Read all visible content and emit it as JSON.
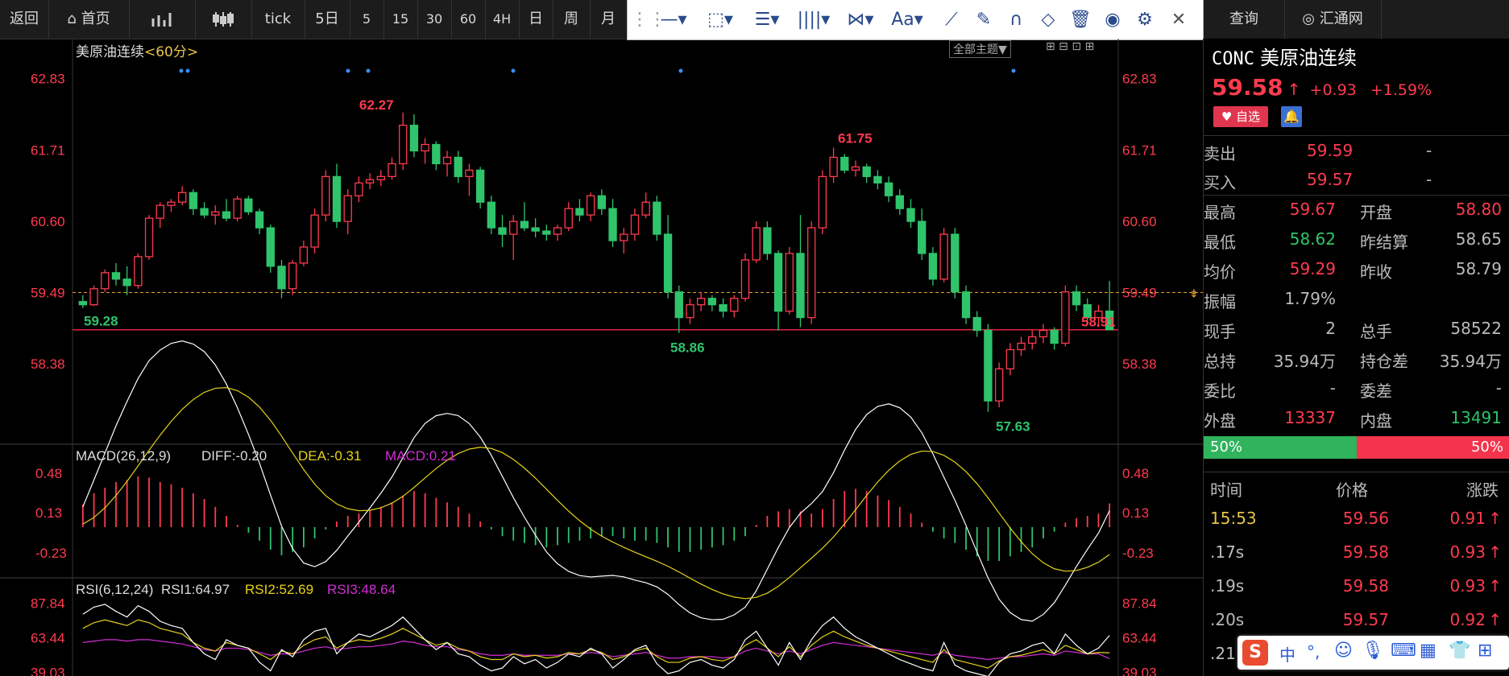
{
  "topbar": {
    "items": [
      "返回",
      "首页",
      "",
      "",
      "tick",
      "5日",
      "5",
      "15",
      "30",
      "60",
      "4H",
      "日",
      "周",
      "月"
    ],
    "right_items": [
      "查询",
      "汇通网"
    ]
  },
  "toolbar": {
    "tools": [
      "line-tool",
      "rect-tool",
      "fib-tool",
      "parallel-tool",
      "pattern-tool",
      "text-tool",
      "ruler-tool",
      "pen-tool",
      "magnet-tool",
      "eraser-tool",
      "delete-tool",
      "eye-tool",
      "settings-tool",
      "close-tool"
    ],
    "text_label": "Aa"
  },
  "chart": {
    "title": "美原油连续",
    "period": "<60分>",
    "theme_button": "全部主题▼",
    "price_ticks": [
      "62.83",
      "61.71",
      "60.60",
      "59.49",
      "58.38"
    ],
    "annotations": {
      "high1": "62.27",
      "high2": "61.75",
      "low1": "59.28",
      "low2": "58.86",
      "low3": "57.63",
      "last": "58.91"
    },
    "macd": {
      "title": "MACD(26,12,9)",
      "diff": "DIFF:-0.20",
      "dea": "DEA:-0.31",
      "macd": "MACD:0.21",
      "ticks": [
        "0.48",
        "0.13",
        "-0.23"
      ]
    },
    "rsi": {
      "title": "RSI(6,12,24)",
      "rsi1": "RSI1:64.97",
      "rsi2": "RSI2:52.69",
      "rsi3": "RSI3:48.64",
      "ticks": [
        "87.84",
        "63.44",
        "39.03"
      ]
    },
    "colors": {
      "up": "#ff3b4e",
      "down": "#2fc46c",
      "bg": "#000",
      "diff": "#ffffff",
      "dea": "#e6d21a",
      "macd": "#d22ed6"
    }
  },
  "chart_data": {
    "type": "candlestick",
    "price_range": [
      57.3,
      63.2
    ],
    "candles": [
      [
        59.35,
        59.45,
        59.25,
        59.3
      ],
      [
        59.3,
        59.6,
        59.28,
        59.55
      ],
      [
        59.55,
        59.85,
        59.5,
        59.8
      ],
      [
        59.8,
        59.95,
        59.6,
        59.7
      ],
      [
        59.7,
        59.9,
        59.45,
        59.6
      ],
      [
        59.6,
        60.1,
        59.55,
        60.05
      ],
      [
        60.05,
        60.7,
        60.0,
        60.65
      ],
      [
        60.65,
        60.9,
        60.5,
        60.85
      ],
      [
        60.85,
        60.95,
        60.75,
        60.9
      ],
      [
        60.9,
        61.15,
        60.85,
        61.05
      ],
      [
        61.05,
        61.1,
        60.7,
        60.8
      ],
      [
        60.8,
        60.9,
        60.65,
        60.7
      ],
      [
        60.7,
        60.85,
        60.55,
        60.75
      ],
      [
        60.75,
        60.95,
        60.6,
        60.65
      ],
      [
        60.65,
        61.0,
        60.6,
        60.95
      ],
      [
        60.95,
        61.0,
        60.7,
        60.75
      ],
      [
        60.75,
        60.8,
        60.4,
        60.5
      ],
      [
        60.5,
        60.55,
        59.8,
        59.9
      ],
      [
        59.9,
        60.0,
        59.4,
        59.55
      ],
      [
        59.55,
        60.0,
        59.45,
        59.95
      ],
      [
        59.95,
        60.3,
        59.9,
        60.2
      ],
      [
        60.2,
        60.8,
        60.1,
        60.7
      ],
      [
        60.7,
        61.4,
        60.6,
        61.3
      ],
      [
        61.3,
        61.5,
        60.5,
        60.6
      ],
      [
        60.6,
        61.1,
        60.4,
        61.0
      ],
      [
        61.0,
        61.3,
        60.9,
        61.2
      ],
      [
        61.2,
        61.35,
        61.1,
        61.25
      ],
      [
        61.25,
        61.4,
        61.15,
        61.3
      ],
      [
        61.3,
        61.6,
        61.25,
        61.5
      ],
      [
        61.5,
        62.3,
        61.4,
        62.1
      ],
      [
        62.1,
        62.27,
        61.6,
        61.7
      ],
      [
        61.7,
        61.9,
        61.5,
        61.8
      ],
      [
        61.8,
        61.85,
        61.4,
        61.5
      ],
      [
        61.5,
        61.7,
        61.3,
        61.6
      ],
      [
        61.6,
        61.7,
        61.2,
        61.3
      ],
      [
        61.3,
        61.5,
        61.0,
        61.4
      ],
      [
        61.4,
        61.45,
        60.8,
        60.9
      ],
      [
        60.9,
        61.0,
        60.4,
        60.5
      ],
      [
        60.5,
        60.7,
        60.2,
        60.4
      ],
      [
        60.4,
        60.7,
        60.0,
        60.6
      ],
      [
        60.6,
        60.9,
        60.45,
        60.5
      ],
      [
        60.5,
        60.65,
        60.35,
        60.45
      ],
      [
        60.45,
        60.55,
        60.3,
        60.4
      ],
      [
        60.4,
        60.55,
        60.3,
        60.5
      ],
      [
        60.5,
        60.9,
        60.45,
        60.8
      ],
      [
        60.8,
        60.95,
        60.6,
        60.7
      ],
      [
        60.7,
        61.05,
        60.6,
        61.0
      ],
      [
        61.0,
        61.1,
        60.7,
        60.8
      ],
      [
        60.8,
        60.95,
        60.2,
        60.3
      ],
      [
        60.3,
        60.5,
        60.1,
        60.4
      ],
      [
        60.4,
        60.8,
        60.3,
        60.7
      ],
      [
        60.7,
        61.05,
        60.65,
        60.9
      ],
      [
        60.9,
        61.0,
        60.3,
        60.4
      ],
      [
        60.4,
        60.7,
        59.4,
        59.5
      ],
      [
        59.5,
        59.6,
        58.86,
        59.1
      ],
      [
        59.1,
        59.4,
        59.0,
        59.3
      ],
      [
        59.3,
        59.5,
        59.2,
        59.4
      ],
      [
        59.4,
        59.45,
        59.2,
        59.3
      ],
      [
        59.3,
        59.4,
        59.1,
        59.2
      ],
      [
        59.2,
        59.45,
        59.1,
        59.4
      ],
      [
        59.4,
        60.1,
        59.35,
        60.0
      ],
      [
        60.0,
        60.6,
        59.95,
        60.5
      ],
      [
        60.5,
        60.6,
        60.0,
        60.1
      ],
      [
        60.1,
        60.15,
        58.9,
        59.2
      ],
      [
        59.2,
        60.2,
        59.15,
        60.1
      ],
      [
        60.1,
        60.7,
        58.95,
        59.1
      ],
      [
        59.1,
        60.6,
        59.0,
        60.5
      ],
      [
        60.5,
        61.4,
        60.4,
        61.3
      ],
      [
        61.3,
        61.75,
        61.2,
        61.6
      ],
      [
        61.6,
        61.65,
        61.35,
        61.4
      ],
      [
        61.4,
        61.55,
        61.3,
        61.45
      ],
      [
        61.45,
        61.5,
        61.2,
        61.3
      ],
      [
        61.3,
        61.4,
        61.1,
        61.2
      ],
      [
        61.2,
        61.3,
        60.9,
        61.0
      ],
      [
        61.0,
        61.1,
        60.7,
        60.8
      ],
      [
        60.8,
        60.95,
        60.5,
        60.6
      ],
      [
        60.6,
        60.8,
        60.0,
        60.1
      ],
      [
        60.1,
        60.2,
        59.6,
        59.7
      ],
      [
        59.7,
        60.5,
        59.65,
        60.4
      ],
      [
        60.4,
        60.5,
        59.4,
        59.5
      ],
      [
        59.5,
        59.6,
        59.0,
        59.1
      ],
      [
        59.1,
        59.2,
        58.8,
        58.9
      ],
      [
        58.9,
        59.0,
        57.63,
        57.8
      ],
      [
        57.8,
        58.4,
        57.7,
        58.3
      ],
      [
        58.3,
        58.7,
        58.2,
        58.6
      ],
      [
        58.6,
        58.8,
        58.5,
        58.7
      ],
      [
        58.7,
        58.9,
        58.6,
        58.8
      ],
      [
        58.8,
        59.0,
        58.7,
        58.9
      ],
      [
        58.9,
        58.95,
        58.6,
        58.7
      ],
      [
        58.7,
        59.6,
        58.65,
        59.5
      ],
      [
        59.5,
        59.6,
        59.2,
        59.3
      ],
      [
        59.3,
        59.4,
        59.0,
        59.1
      ],
      [
        59.1,
        59.3,
        58.95,
        59.2
      ],
      [
        59.2,
        59.67,
        58.95,
        58.91
      ]
    ],
    "macd_hist": [
      0.2,
      0.3,
      0.35,
      0.4,
      0.42,
      0.45,
      0.44,
      0.4,
      0.38,
      0.35,
      0.3,
      0.25,
      0.18,
      0.1,
      0.02,
      -0.05,
      -0.12,
      -0.2,
      -0.25,
      -0.22,
      -0.18,
      -0.1,
      -0.02,
      0.05,
      0.1,
      0.12,
      0.15,
      0.18,
      0.22,
      0.28,
      0.32,
      0.3,
      0.26,
      0.22,
      0.18,
      0.12,
      0.05,
      -0.02,
      -0.08,
      -0.12,
      -0.14,
      -0.16,
      -0.18,
      -0.16,
      -0.14,
      -0.12,
      -0.1,
      -0.08,
      -0.08,
      -0.1,
      -0.12,
      -0.12,
      -0.14,
      -0.18,
      -0.22,
      -0.22,
      -0.2,
      -0.18,
      -0.16,
      -0.12,
      -0.08,
      0.02,
      0.1,
      0.14,
      0.16,
      0.14,
      0.12,
      0.16,
      0.25,
      0.32,
      0.34,
      0.32,
      0.28,
      0.24,
      0.18,
      0.12,
      0.04,
      -0.04,
      -0.1,
      -0.14,
      -0.2,
      -0.26,
      -0.3,
      -0.3,
      -0.26,
      -0.22,
      -0.18,
      -0.1,
      -0.04,
      0.04,
      0.08,
      0.1,
      0.12,
      0.21
    ],
    "rsi1": [
      80,
      85,
      87,
      82,
      78,
      86,
      82,
      75,
      72,
      70,
      60,
      52,
      48,
      62,
      58,
      56,
      46,
      40,
      55,
      50,
      62,
      68,
      70,
      52,
      60,
      66,
      64,
      68,
      72,
      78,
      70,
      62,
      55,
      60,
      52,
      50,
      44,
      40,
      42,
      50,
      45,
      48,
      42,
      46,
      52,
      50,
      56,
      52,
      42,
      48,
      55,
      58,
      45,
      38,
      40,
      46,
      48,
      44,
      42,
      48,
      62,
      68,
      56,
      44,
      60,
      48,
      62,
      72,
      78,
      70,
      64,
      60,
      56,
      52,
      48,
      45,
      42,
      40,
      60,
      44,
      40,
      38,
      36,
      46,
      52,
      54,
      58,
      60,
      52,
      66,
      58,
      52,
      56,
      64.97
    ],
    "rsi2": [
      70,
      74,
      76,
      74,
      72,
      76,
      74,
      70,
      68,
      66,
      60,
      56,
      54,
      60,
      58,
      56,
      52,
      48,
      54,
      52,
      58,
      62,
      64,
      56,
      60,
      62,
      61,
      63,
      66,
      70,
      66,
      62,
      58,
      60,
      56,
      54,
      50,
      48,
      48,
      52,
      50,
      51,
      49,
      50,
      53,
      52,
      55,
      53,
      48,
      50,
      54,
      56,
      50,
      46,
      46,
      49,
      50,
      48,
      47,
      50,
      58,
      62,
      56,
      50,
      57,
      50,
      58,
      64,
      68,
      64,
      61,
      58,
      56,
      54,
      52,
      50,
      48,
      46,
      55,
      48,
      46,
      44,
      42,
      47,
      50,
      51,
      53,
      55,
      52,
      58,
      55,
      52,
      53,
      52.69
    ],
    "rsi3": [
      60,
      61,
      62,
      62,
      61,
      62,
      62,
      61,
      60,
      59,
      57,
      55,
      54,
      56,
      56,
      55,
      53,
      51,
      52,
      52,
      54,
      56,
      57,
      55,
      56,
      57,
      57,
      58,
      59,
      61,
      60,
      58,
      57,
      57,
      55,
      54,
      52,
      51,
      51,
      52,
      51,
      51,
      51,
      51,
      52,
      52,
      53,
      52,
      50,
      51,
      52,
      53,
      51,
      49,
      49,
      50,
      50,
      50,
      49,
      50,
      54,
      56,
      54,
      52,
      54,
      52,
      55,
      58,
      60,
      59,
      58,
      57,
      56,
      55,
      54,
      53,
      52,
      51,
      53,
      51,
      50,
      49,
      48,
      49,
      50,
      50,
      51,
      52,
      51,
      54,
      53,
      52,
      52,
      48.64
    ]
  },
  "quote": {
    "code": "CONC",
    "name": "美原油连续",
    "price": "59.58",
    "arrow": "↑",
    "change": "+0.93",
    "change_pct": "+1.59%",
    "watch_btn": "自选",
    "sell": {
      "label": "卖出",
      "value": "59.59",
      "vol": "-"
    },
    "buy": {
      "label": "买入",
      "value": "59.57",
      "vol": "-"
    },
    "fields": [
      {
        "l1": "最高",
        "v1": "59.67",
        "l2": "开盘",
        "v2": "58.80",
        "c1": "red",
        "c2": "red"
      },
      {
        "l1": "最低",
        "v1": "58.62",
        "l2": "昨结算",
        "v2": "58.65",
        "c1": "green",
        "c2": "grey"
      },
      {
        "l1": "均价",
        "v1": "59.29",
        "l2": "昨收",
        "v2": "58.79",
        "c1": "red",
        "c2": "grey"
      },
      {
        "l1": "振幅",
        "v1": "1.79%",
        "l2": "",
        "v2": "",
        "c1": "grey",
        "c2": "grey"
      },
      {
        "l1": "现手",
        "v1": "2",
        "l2": "总手",
        "v2": "58522",
        "c1": "grey",
        "c2": "grey"
      },
      {
        "l1": "总持",
        "v1": "35.94万",
        "l2": "持仓差",
        "v2": "35.94万",
        "c1": "grey",
        "c2": "grey"
      },
      {
        "l1": "委比",
        "v1": "-",
        "l2": "委差",
        "v2": "-",
        "c1": "grey",
        "c2": "grey"
      },
      {
        "l1": "外盘",
        "v1": "13337",
        "l2": "内盘",
        "v2": "13491",
        "c1": "red",
        "c2": "green"
      }
    ],
    "bar_left": "50%",
    "bar_right": "50%",
    "bar_fraction": 0.5,
    "ticks_header": {
      "time": "时间",
      "price": "价格",
      "change": "涨跌"
    },
    "ticks": [
      {
        "time": "15:53",
        "price": "59.56",
        "chg": "0.91"
      },
      {
        "time": ".17s",
        "price": "59.58",
        "chg": "0.93"
      },
      {
        "time": ".19s",
        "price": "59.58",
        "chg": "0.93"
      },
      {
        "time": ".20s",
        "price": "59.57",
        "chg": "0.92"
      },
      {
        "time": ".21",
        "price": "",
        "chg": ""
      }
    ]
  },
  "ime": {
    "label": "中",
    "punct": "°,"
  }
}
